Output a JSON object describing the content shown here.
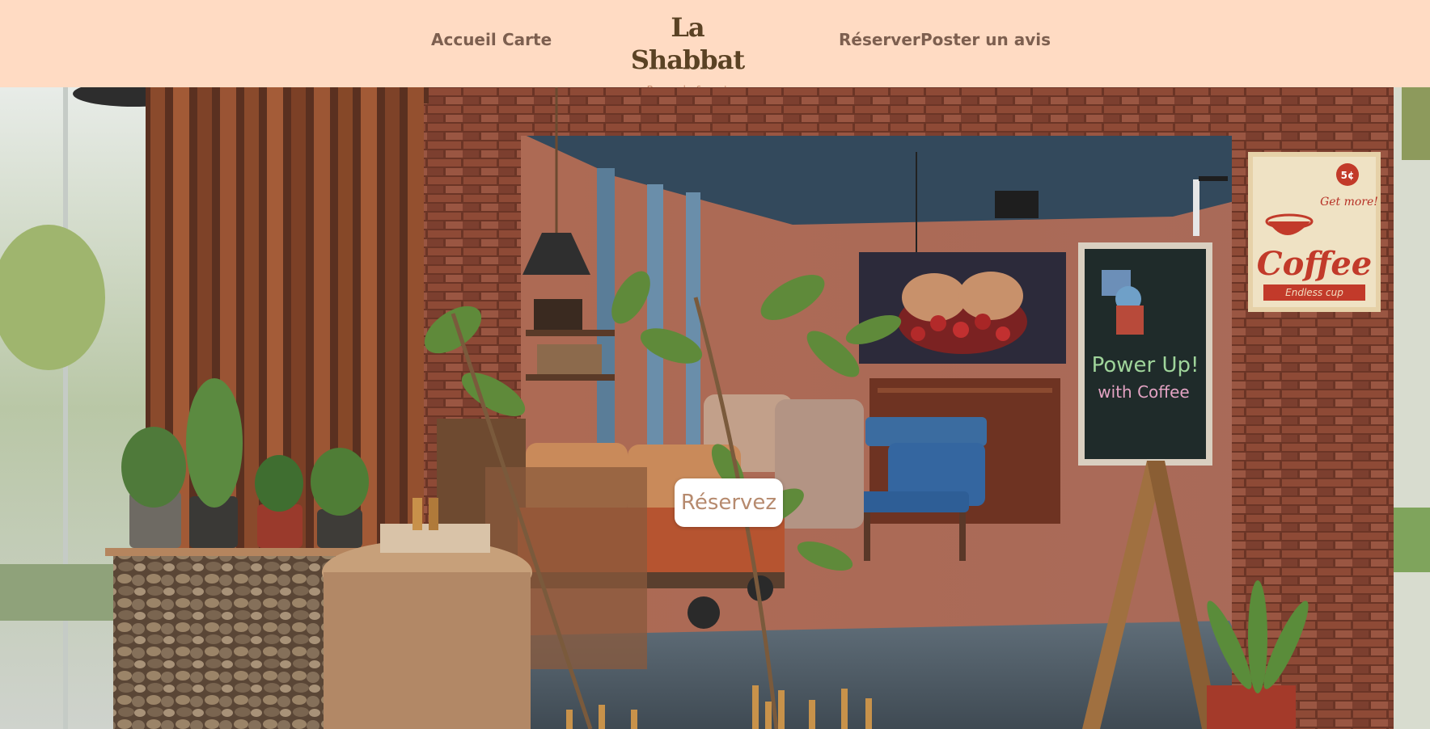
{
  "header": {
    "nav_left": [
      {
        "label": "Accueil"
      },
      {
        "label": "Carte"
      }
    ],
    "logo": {
      "title": "La Shabbat",
      "subtitle": "Brunch & co'"
    },
    "nav_right": [
      {
        "label": "Réserver"
      },
      {
        "label": "Poster un avis"
      }
    ]
  },
  "hero": {
    "cta_label": "Réservez",
    "chalkboard_text": [
      "Power Up!",
      "with Coffee"
    ],
    "coffee_sign": {
      "price": "5¢",
      "tagline": "Get more!",
      "word": "Coffee",
      "banner": "Endless cup"
    }
  },
  "colors": {
    "header_bg": "#ffdbc3",
    "nav_text": "#7d5f4f",
    "logo_text": "#5a4224",
    "logo_subtitle": "#c99072",
    "cta_text": "#b68a6e"
  }
}
